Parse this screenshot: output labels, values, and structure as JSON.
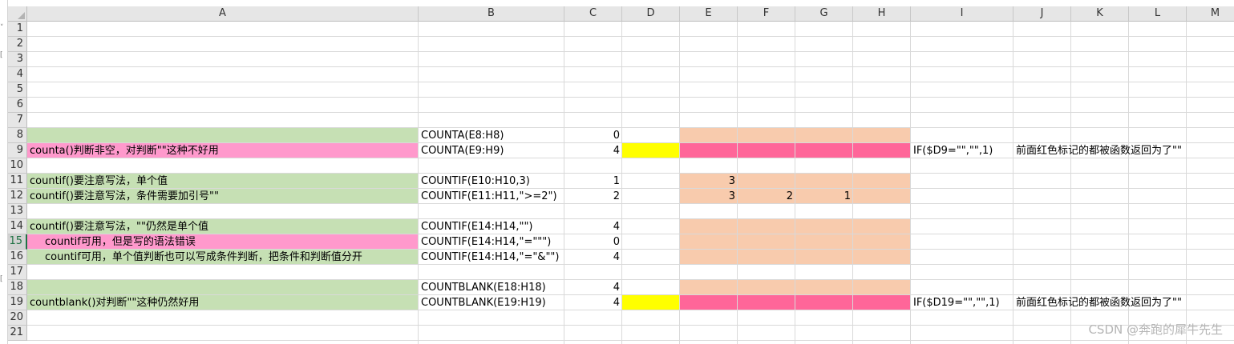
{
  "columns": [
    "A",
    "B",
    "C",
    "D",
    "E",
    "F",
    "G",
    "H",
    "I",
    "J",
    "K",
    "L",
    "M"
  ],
  "rows": [
    "1",
    "2",
    "3",
    "4",
    "5",
    "6",
    "7",
    "8",
    "9",
    "10",
    "11",
    "12",
    "13",
    "14",
    "15",
    "16",
    "17",
    "18",
    "19",
    "20",
    "21"
  ],
  "selected_row": "15",
  "colors": {
    "green": "#c6e0b4",
    "pink": "#ff99cc",
    "peach": "#f8cbad",
    "hotpink": "#ff6699",
    "yellow": "#ffff00"
  },
  "cells": {
    "A9": "counta()判断非空，对判断\"\"这种不好用",
    "A11": "countif()要注意写法，单个值",
    "A12": "countif()要注意写法，条件需要加引号\"\"",
    "A14": "countif()要注意写法，\"\"仍然是单个值",
    "A15": "countif可用，但是写的语法错误",
    "A16": "countif可用，单个值判断也可以写成条件判断，把条件和判断值分开",
    "A19": "countblank()对判断\"\"这种仍然好用",
    "B8": "COUNTA(E8:H8)",
    "B9": "COUNTA(E9:H9)",
    "B11": "COUNTIF(E10:H10,3)",
    "B12": "COUNTIF(E11:H11,\">=2\")",
    "B14": "COUNTIF(E14:H14,\"\")",
    "B15": "COUNTIF(E14:H14,\"=\"\"\")",
    "B16": "COUNTIF(E14:H14,\"=\"&\"\")",
    "B18": "COUNTBLANK(E18:H18)",
    "B19": "COUNTBLANK(E19:H19)",
    "C8": "0",
    "C9": "4",
    "C11": "1",
    "C12": "2",
    "C14": "4",
    "C15": "0",
    "C16": "4",
    "C18": "4",
    "C19": "4",
    "E11": "3",
    "E12": "3",
    "F12": "2",
    "G12": "1",
    "I9": "IF($D9=\"\",\"\",1)",
    "I19": "IF($D19=\"\",\"\",1)",
    "J9": "前面红色标记的都被函数返回为了\"\"",
    "J19": "前面红色标记的都被函数返回为了\"\""
  },
  "watermark": "CSDN @奔跑的犀牛先生"
}
